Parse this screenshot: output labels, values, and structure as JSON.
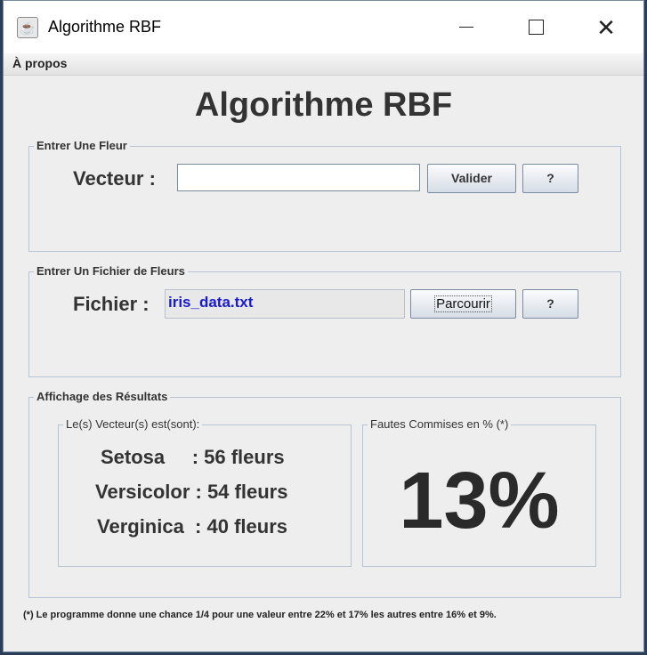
{
  "window": {
    "title": "Algorithme RBF"
  },
  "menu": {
    "items": [
      "À propos"
    ]
  },
  "heading": "Algorithme RBF",
  "single_flower": {
    "group_title": "Entrer Une Fleur",
    "label": "Vecteur :",
    "input_value": "",
    "validate_label": "Valider",
    "help_label": "?"
  },
  "file_input": {
    "group_title": "Entrer Un Fichier de Fleurs",
    "label": "Fichier :",
    "file_name": "iris_data.txt",
    "browse_label": "Parcourir",
    "help_label": "?"
  },
  "results": {
    "group_title": "Affichage des Résultats",
    "vectors_title": "Le(s) Vecteur(s) est(sont):",
    "lines": [
      "Setosa     : 56 fleurs",
      "Versicolor : 54 fleurs",
      "Verginica  : 40 fleurs"
    ],
    "errors_title": "Fautes Commises en % (*)",
    "error_percent": "13%"
  },
  "footnote": "(*) Le programme donne une chance 1/4 pour une valeur entre 22% et 17% les autres entre 16% et 9%."
}
